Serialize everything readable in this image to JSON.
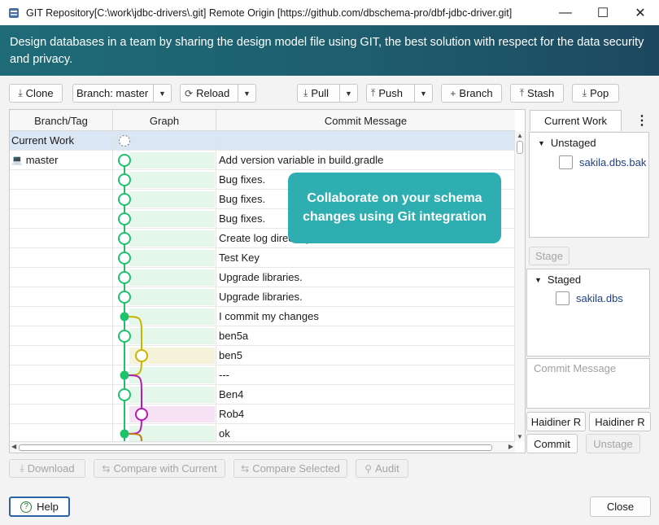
{
  "window": {
    "title": "GIT Repository[C:\\work\\jdbc-drivers\\.git] Remote Origin [https://github.com/dbschema-pro/dbf-jdbc-driver.git]",
    "minimize": "—",
    "maximize": "☐",
    "close": "✕"
  },
  "banner": {
    "text": "Design databases in a team by sharing the design model file using GIT, the best solution with respect for the data security and privacy."
  },
  "toolbar": {
    "clone": "Clone",
    "branch": "Branch: master",
    "reload": "Reload",
    "pull": "Pull",
    "push": "Push",
    "new_branch": "Branch",
    "stash": "Stash",
    "pop": "Pop"
  },
  "table": {
    "columns": [
      "Branch/Tag",
      "Graph",
      "Commit Message"
    ],
    "rows": [
      {
        "branch": "Current Work",
        "message": ""
      },
      {
        "branch": "master",
        "message": "Add version variable in build.gradle"
      },
      {
        "branch": "",
        "message": "Bug fixes."
      },
      {
        "branch": "",
        "message": "Bug fixes."
      },
      {
        "branch": "",
        "message": "Bug fixes."
      },
      {
        "branch": "",
        "message": "Create log directory"
      },
      {
        "branch": "",
        "message": "Test Key"
      },
      {
        "branch": "",
        "message": "Upgrade libraries."
      },
      {
        "branch": "",
        "message": "Upgrade libraries."
      },
      {
        "branch": "",
        "message": "I commit my changes"
      },
      {
        "branch": "",
        "message": "ben5a"
      },
      {
        "branch": "",
        "message": "ben5"
      },
      {
        "branch": "",
        "message": "---"
      },
      {
        "branch": "",
        "message": "Ben4"
      },
      {
        "branch": "",
        "message": "Rob4"
      },
      {
        "branch": "",
        "message": "ok"
      }
    ]
  },
  "tooltip": {
    "line1": "Collaborate on your schema",
    "line2": "changes using Git integration"
  },
  "right_panel": {
    "tab": "Current Work",
    "more": "⋮",
    "unstaged_label": "Unstaged",
    "unstaged_files": [
      "sakila.dbs.bak"
    ],
    "stage": "Stage",
    "staged_label": "Staged",
    "staged_files": [
      "sakila.dbs"
    ],
    "commit_placeholder": "Commit Message",
    "author_name": "Haidiner R",
    "author_email": "Haidiner R",
    "commit": "Commit",
    "unstage": "Unstage"
  },
  "bottom": {
    "download": "Download",
    "compare_current": "Compare with Current",
    "compare_selected": "Compare Selected",
    "audit": "Audit",
    "help": "Help",
    "close": "Close"
  },
  "colors": {
    "green": "#1fc26c",
    "yellow": "#c9b400",
    "magenta": "#b41cb4",
    "orange": "#c77a10",
    "banner": "#1f6b78",
    "tooltip": "#2eaeb0"
  }
}
